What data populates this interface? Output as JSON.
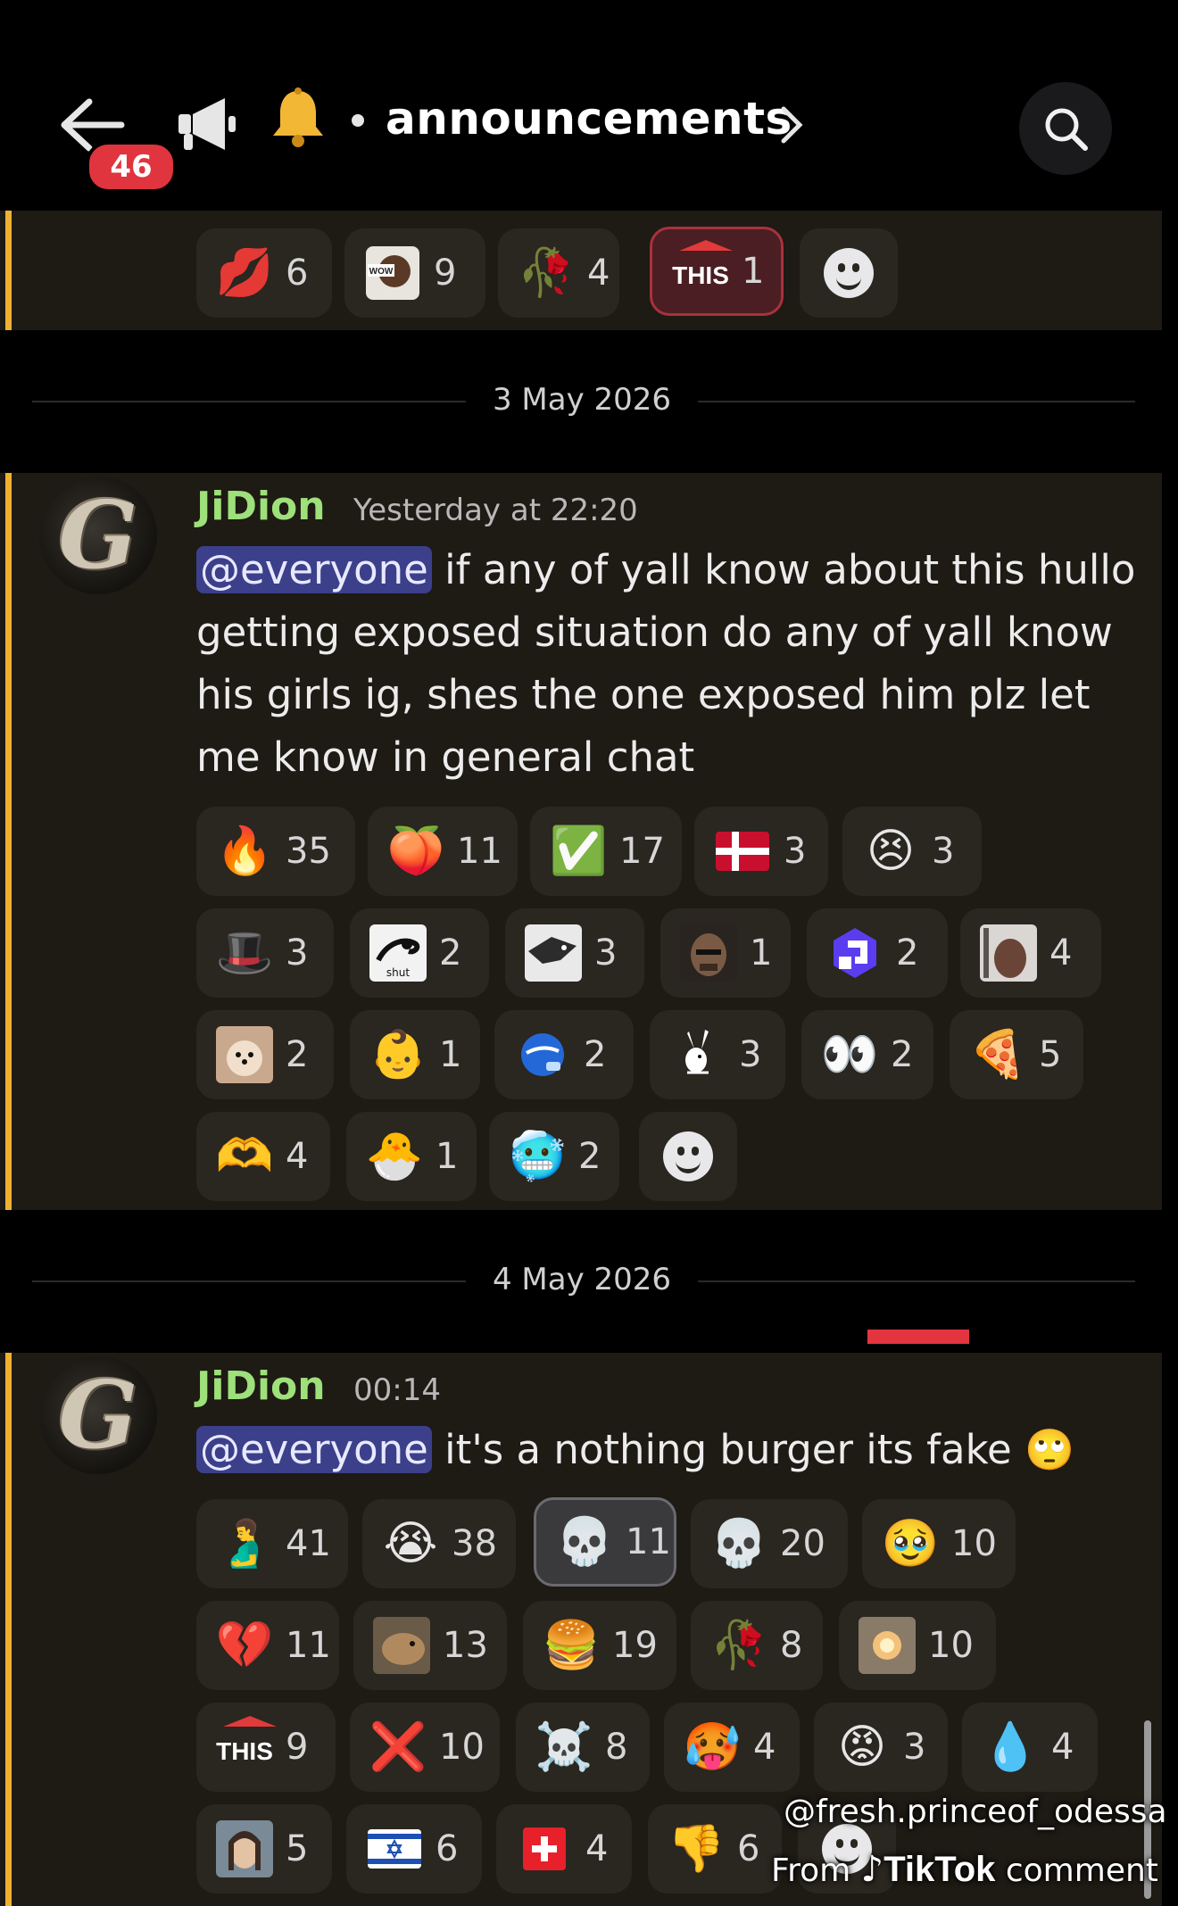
{
  "header": {
    "unread_count": "46",
    "channel_name": "announcements",
    "icons": [
      "back-arrow-icon",
      "megaphone-icon",
      "bell-icon",
      "chevron-right-icon",
      "search-icon"
    ]
  },
  "top_reactions": [
    {
      "emoji": "💋",
      "icon": "lips",
      "count": "6"
    },
    {
      "emoji": "",
      "icon": "wow-image",
      "label": "WOW",
      "count": "9"
    },
    {
      "emoji": "🥀",
      "icon": "wilted-rose",
      "count": "4"
    },
    {
      "emoji": "",
      "icon": "this-sticker",
      "label": "THIS",
      "count": "1",
      "active": true
    },
    {
      "icon": "add-reaction-icon"
    }
  ],
  "date_separators": [
    "3 May 2026",
    "4 May 2026"
  ],
  "messages": [
    {
      "author": "JiDion",
      "timestamp": "Yesterday at 22:20",
      "mention": "@everyone",
      "lines": [
        " if any of yall know about this hullo",
        "getting exposed situation do any of yall know",
        "his girls ig, shes the one exposed him plz let",
        "me know in general chat"
      ],
      "reaction_rows": [
        [
          {
            "emoji": "🔥",
            "count": "35"
          },
          {
            "emoji": "🍑",
            "icon": "twerk-image",
            "count": "11"
          },
          {
            "emoji": "✅",
            "count": "17"
          },
          {
            "emoji": "🇩🇰",
            "count": "3"
          },
          {
            "emoji": "😣",
            "icon": "anime-girl-image",
            "count": "3"
          }
        ],
        [
          {
            "emoji": "🎩",
            "icon": "peanut-hat-image",
            "count": "3"
          },
          {
            "emoji": "👌",
            "icon": "shut-image",
            "label": "shut",
            "count": "2"
          },
          {
            "emoji": "🐺",
            "icon": "wolf-image",
            "count": "3"
          },
          {
            "emoji": "😠",
            "icon": "bald-man-image",
            "count": "1"
          },
          {
            "emoji": "",
            "icon": "purple-logo-image",
            "count": "2"
          },
          {
            "emoji": "🧍",
            "icon": "person-image",
            "count": "4"
          }
        ],
        [
          {
            "emoji": "🐶",
            "icon": "pomeranian-image",
            "count": "2"
          },
          {
            "emoji": "👶",
            "count": "1"
          },
          {
            "emoji": "🌍",
            "icon": "blue-globe-image",
            "count": "2"
          },
          {
            "emoji": "🐰",
            "icon": "playboy-bunny",
            "count": "3"
          },
          {
            "emoji": "👀",
            "count": "2"
          },
          {
            "emoji": "🍕",
            "count": "5"
          }
        ],
        [
          {
            "emoji": "🫶",
            "count": "4"
          },
          {
            "emoji": "🐣",
            "count": "1"
          },
          {
            "emoji": "🥶",
            "count": "2"
          },
          {
            "icon": "add-reaction-icon"
          }
        ]
      ]
    },
    {
      "author": "JiDion",
      "timestamp": "00:14",
      "mention": "@everyone",
      "text": " it's a nothing burger its fake 🙄",
      "reaction_rows": [
        [
          {
            "emoji": "🫃",
            "count": "41"
          },
          {
            "emoji": "😭",
            "count": "38"
          },
          {
            "emoji": "💀",
            "count": "11",
            "selected": true
          },
          {
            "emoji": "💀",
            "count": "20"
          },
          {
            "emoji": "🥹",
            "count": "10"
          }
        ],
        [
          {
            "emoji": "💔",
            "count": "11"
          },
          {
            "emoji": "🐹",
            "icon": "capybara-image",
            "count": "13"
          },
          {
            "emoji": "🍔",
            "count": "19"
          },
          {
            "emoji": "🥀",
            "count": "8"
          },
          {
            "emoji": "💥",
            "icon": "explosion-image",
            "count": "10"
          }
        ],
        [
          {
            "emoji": "",
            "icon": "this-sticker",
            "label": "THIS",
            "count": "9"
          },
          {
            "emoji": "❌",
            "count": "10"
          },
          {
            "emoji": "☠️",
            "count": "8"
          },
          {
            "emoji": "🥵",
            "count": "4"
          },
          {
            "emoji": "😡",
            "count": "3"
          },
          {
            "emoji": "💧",
            "count": "4"
          }
        ],
        [
          {
            "emoji": "🧑",
            "icon": "girl-photo-image",
            "count": "5"
          },
          {
            "emoji": "🇮🇱",
            "count": "6"
          },
          {
            "emoji": "🇨🇭",
            "count": "4"
          },
          {
            "emoji": "👎",
            "count": "6"
          },
          {
            "icon": "add-reaction-icon"
          }
        ]
      ]
    }
  ],
  "watermark": {
    "handle": "@fresh.princeof_odessa",
    "from": "From",
    "brand": "TikTok",
    "suffix": "comment"
  },
  "colors": {
    "background": "#000000",
    "message_bg": "#1e1a14",
    "highlight": "#f0b132",
    "username": "#9ee07a",
    "mention_bg": "#3c3f8a",
    "badge": "#e0343e"
  }
}
